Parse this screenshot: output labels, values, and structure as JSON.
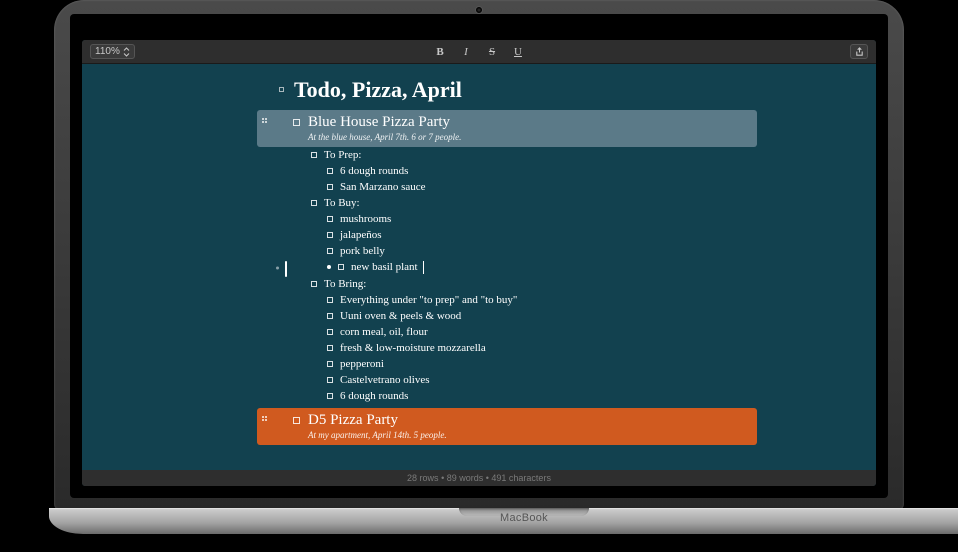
{
  "toolbar": {
    "zoom": "110%",
    "bold": "B",
    "italic": "I",
    "strike": "S",
    "underline": "U"
  },
  "doc": {
    "title": "Todo, Pizza, April",
    "sections": [
      {
        "title": "Blue House Pizza Party",
        "subtitle": "At the blue house, April 7th. 6 or 7 people.",
        "selected": true,
        "groups": [
          {
            "label": "To Prep:",
            "items": [
              "6 dough rounds",
              "San Marzano sauce"
            ]
          },
          {
            "label": "To Buy:",
            "items": [
              "mushrooms",
              "jalapeños",
              "pork belly",
              "new basil plant"
            ]
          },
          {
            "label": "To Bring:",
            "items": [
              "Everything under \"to prep\" and \"to buy\"",
              "Uuni oven & peels & wood",
              "corn meal, oil, flour",
              "fresh & low-moisture mozzarella",
              "pepperoni",
              "Castelvetrano olives",
              "6 dough rounds"
            ]
          }
        ]
      },
      {
        "title": "D5 Pizza Party",
        "subtitle": "At my apartment, April 14th. 5 people.",
        "color": "orange"
      }
    ]
  },
  "status": {
    "rows": "28 rows",
    "words": "89 words",
    "chars": "491 characters"
  },
  "device": {
    "label": "MacBook"
  }
}
